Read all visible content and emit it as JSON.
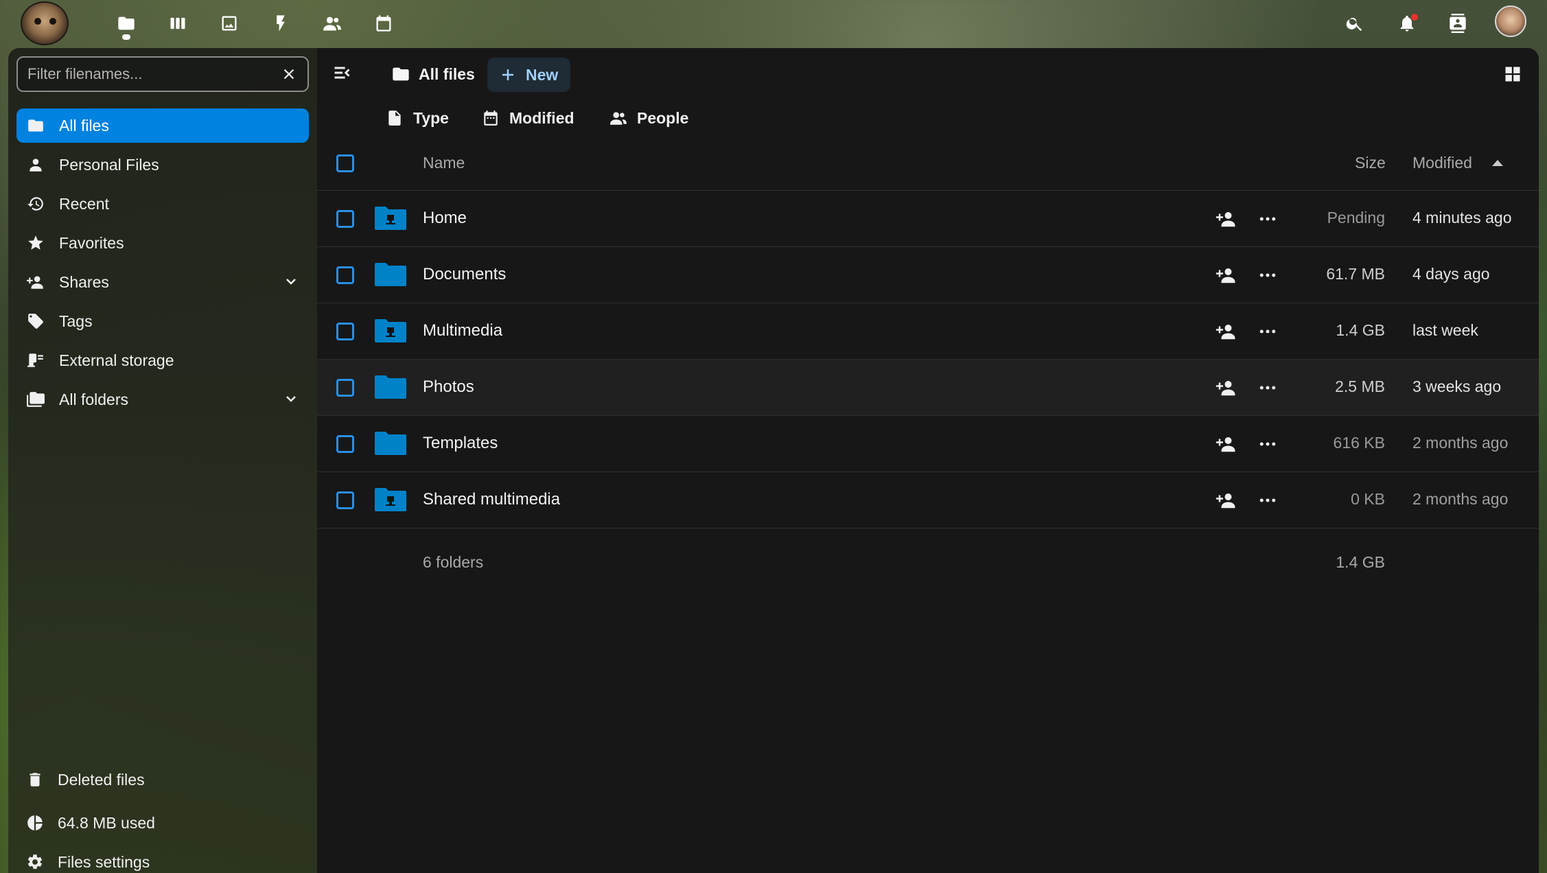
{
  "header": {
    "apps": [
      {
        "name": "files-app-icon"
      },
      {
        "name": "dashboard-app-icon"
      },
      {
        "name": "photos-app-icon"
      },
      {
        "name": "activity-app-icon"
      },
      {
        "name": "contacts-app-icon"
      },
      {
        "name": "calendar-app-icon"
      }
    ]
  },
  "sidebar": {
    "filter_placeholder": "Filter filenames...",
    "items": [
      {
        "label": "All files",
        "icon": "folder-icon",
        "active": true
      },
      {
        "label": "Personal Files",
        "icon": "account-icon"
      },
      {
        "label": "Recent",
        "icon": "history-icon"
      },
      {
        "label": "Favorites",
        "icon": "star-icon"
      },
      {
        "label": "Shares",
        "icon": "share-icon"
      },
      {
        "label": "Tags",
        "icon": "tag-icon"
      },
      {
        "label": "External storage",
        "icon": "network-folder-icon"
      },
      {
        "label": "All folders",
        "icon": "folder-multiple-icon"
      }
    ],
    "deleted_label": "Deleted files",
    "quota_label": "64.8 MB used",
    "settings_label": "Files settings"
  },
  "toolbar": {
    "breadcrumb": "All files",
    "new_label": "New"
  },
  "filters": {
    "type_label": "Type",
    "modified_label": "Modified",
    "people_label": "People"
  },
  "table": {
    "col_name": "Name",
    "col_size": "Size",
    "col_modified": "Modified",
    "rows": [
      {
        "name": "Home",
        "size": "Pending",
        "modified": "4 minutes ago",
        "kind": "external"
      },
      {
        "name": "Documents",
        "size": "61.7 MB",
        "modified": "4 days ago",
        "kind": "folder"
      },
      {
        "name": "Multimedia",
        "size": "1.4 GB",
        "modified": "last week",
        "kind": "external"
      },
      {
        "name": "Photos",
        "size": "2.5 MB",
        "modified": "3 weeks ago",
        "kind": "folder"
      },
      {
        "name": "Templates",
        "size": "616 KB",
        "modified": "2 months ago",
        "kind": "folder"
      },
      {
        "name": "Shared multimedia",
        "size": "0 KB",
        "modified": "2 months ago",
        "kind": "external"
      }
    ],
    "summary_count": "6 folders",
    "summary_size": "1.4 GB"
  },
  "colors": {
    "accent": "#0082e0",
    "folder": "#0082c9"
  }
}
